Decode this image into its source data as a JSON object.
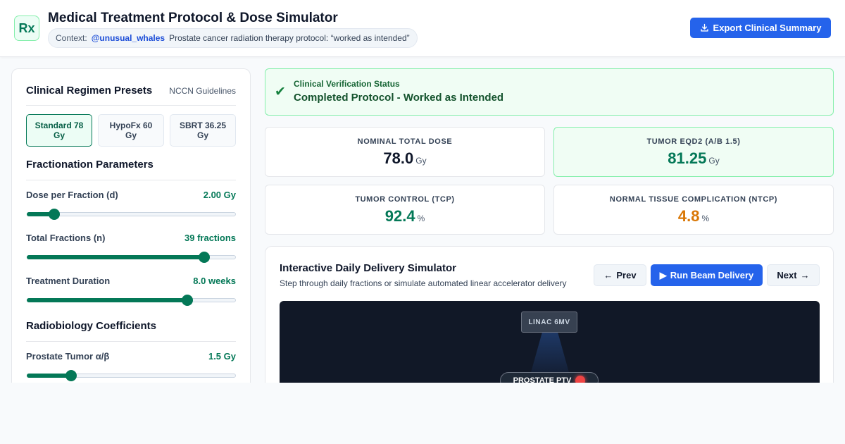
{
  "app": {
    "logo_text": "Rx",
    "title": "Medical Treatment Protocol & Dose Simulator",
    "context": {
      "label": "Context:",
      "handle": "@unusual_whales",
      "text": "Prostate cancer radiation therapy protocol: “worked as intended”"
    },
    "export_label": "Export Clinical Summary"
  },
  "presets": {
    "title": "Clinical Regimen Presets",
    "subtitle": "NCCN Guidelines",
    "items": [
      {
        "label": "Standard 78 Gy",
        "active": true
      },
      {
        "label": "HypoFx 60 Gy",
        "active": false
      },
      {
        "label": "SBRT 36.25 Gy",
        "active": false
      }
    ]
  },
  "fractionation": {
    "title": "Fractionation Parameters",
    "params": [
      {
        "label": "Dose per Fraction (d)",
        "value": "2.00 Gy",
        "level": 0.13
      },
      {
        "label": "Total Fractions (n)",
        "value": "39 fractions",
        "level": 0.85
      },
      {
        "label": "Treatment Duration",
        "value": "8.0 weeks",
        "level": 0.77
      }
    ]
  },
  "radiobiology": {
    "title": "Radiobiology Coefficients",
    "params": [
      {
        "label": "Prostate Tumor α/β",
        "value": "1.5 Gy",
        "level": 0.21
      }
    ]
  },
  "status": {
    "label": "Clinical Verification Status",
    "value": "Completed Protocol - Worked as Intended",
    "color": "#15803d"
  },
  "metrics": [
    {
      "label": "NOMINAL TOTAL DOSE",
      "value": "78.0",
      "unit": "Gy",
      "color": "#0f172a",
      "highlight": false
    },
    {
      "label": "TUMOR EQD2 (Α/Β 1.5)",
      "value": "81.25",
      "unit": "Gy",
      "color": "#047857",
      "highlight": true
    },
    {
      "label": "TUMOR CONTROL (TCP)",
      "value": "92.4",
      "unit": "%",
      "color": "#047857",
      "highlight": false
    },
    {
      "label": "NORMAL TISSUE COMPLICATION (NTCP)",
      "value": "4.8",
      "unit": "%",
      "color": "#d97706",
      "highlight": false
    }
  ],
  "simulator": {
    "title": "Interactive Daily Delivery Simulator",
    "subtitle": "Step through daily fractions or simulate automated linear accelerator delivery",
    "prev_label": "Prev",
    "run_label": "Run Beam Delivery",
    "next_label": "Next",
    "linac_label": "LINAC 6MV",
    "target_label": "PROSTATE PTV"
  },
  "icons": {
    "export": "download-icon",
    "status": "check-icon",
    "prev": "arrow-left-icon",
    "run": "play-icon",
    "next": "arrow-right-icon"
  }
}
